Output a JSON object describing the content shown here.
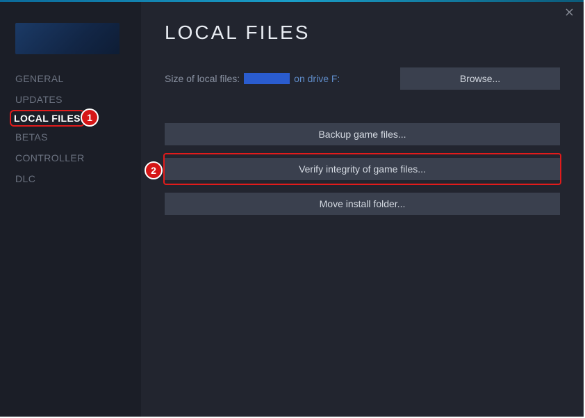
{
  "header": {
    "close_title": "Close"
  },
  "sidebar": {
    "items": [
      {
        "label": "GENERAL"
      },
      {
        "label": "UPDATES"
      },
      {
        "label": "LOCAL FILES"
      },
      {
        "label": "BETAS"
      },
      {
        "label": "CONTROLLER"
      },
      {
        "label": "DLC"
      }
    ],
    "active_index": 2
  },
  "content": {
    "title": "LOCAL FILES",
    "size_label": "Size of local files:",
    "drive_text": "on drive F:",
    "browse_btn": "Browse...",
    "backup_btn": "Backup game files...",
    "verify_btn": "Verify integrity of game files...",
    "move_btn": "Move install folder..."
  },
  "annotations": {
    "badge1": "1",
    "badge2": "2"
  }
}
